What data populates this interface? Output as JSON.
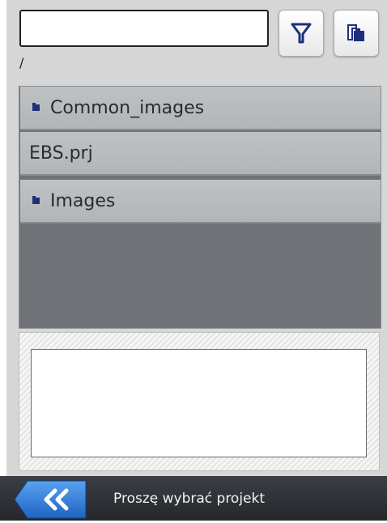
{
  "path_input": {
    "value": "",
    "placeholder": ""
  },
  "toolbar": {
    "filter_icon": "filter-icon",
    "paste_icon": "paste-icon"
  },
  "current_path": "/",
  "files": [
    {
      "name": "Common_images",
      "type": "folder"
    },
    {
      "name": "EBS.prj",
      "type": "file"
    },
    {
      "name": "Images",
      "type": "folder"
    }
  ],
  "footer": {
    "back_icon": "double-chevron-left-icon",
    "status": "Proszę wybrać projekt"
  },
  "colors": {
    "folder": "#1e2f7a",
    "list_bg": "#6f7377",
    "row_bg": "#b8bbbe",
    "footer_bg": "#2b2f33",
    "back_button": "#2f7ad6"
  }
}
